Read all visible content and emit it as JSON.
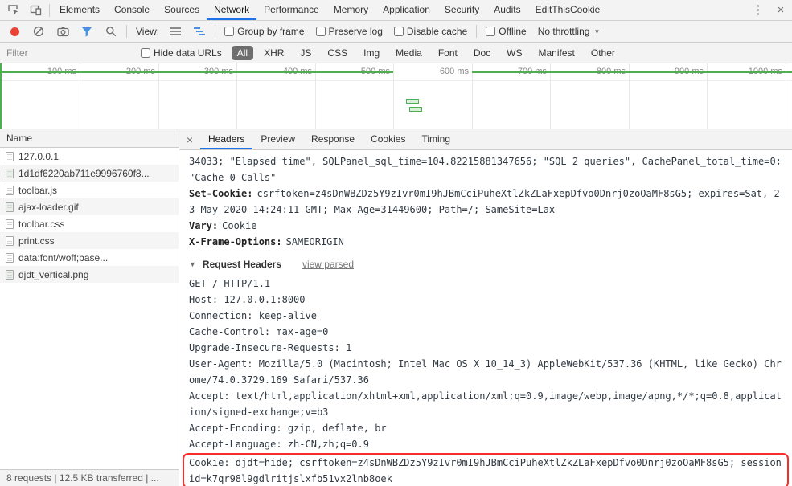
{
  "icons": {
    "kebab_menu": "⋮",
    "close": "×",
    "dropdown_arrow": "▼",
    "disclosure_triangle": "▼"
  },
  "main_tabs": {
    "items": [
      "Elements",
      "Console",
      "Sources",
      "Network",
      "Performance",
      "Memory",
      "Application",
      "Security",
      "Audits",
      "EditThisCookie"
    ],
    "active": "Network"
  },
  "toolbar": {
    "view_label": "View:",
    "checkboxes": [
      "Group by frame",
      "Preserve log",
      "Disable cache",
      "Offline"
    ],
    "throttling": "No throttling"
  },
  "filter_bar": {
    "placeholder": "Filter",
    "hide_data_urls": "Hide data URLs",
    "types": [
      "All",
      "XHR",
      "JS",
      "CSS",
      "Img",
      "Media",
      "Font",
      "Doc",
      "WS",
      "Manifest",
      "Other"
    ],
    "active_type": "All"
  },
  "timeline": {
    "labels": [
      "100 ms",
      "200 ms",
      "300 ms",
      "400 ms",
      "500 ms",
      "600 ms",
      "700 ms",
      "800 ms",
      "900 ms",
      "1000 ms"
    ]
  },
  "requests": {
    "header": "Name",
    "rows": [
      {
        "name": "127.0.0.1",
        "icon": "document-icon"
      },
      {
        "name": "1d1df6220ab711e9996760f8...",
        "icon": "image-icon"
      },
      {
        "name": "toolbar.js",
        "icon": "script-icon"
      },
      {
        "name": "ajax-loader.gif",
        "icon": "image-icon"
      },
      {
        "name": "toolbar.css",
        "icon": "stylesheet-icon"
      },
      {
        "name": "print.css",
        "icon": "stylesheet-icon"
      },
      {
        "name": "data:font/woff;base...",
        "icon": "font-icon"
      },
      {
        "name": "djdt_vertical.png",
        "icon": "image-icon"
      }
    ]
  },
  "details": {
    "close": "×",
    "tabs": [
      "Headers",
      "Preview",
      "Response",
      "Cookies",
      "Timing"
    ],
    "active_tab": "Headers",
    "response": {
      "overflow_line": "34033; \"Elapsed time\", SQLPanel_sql_time=104.82215881347656; \"SQL 2 queries\", CachePanel_total_time=0; \"Cache 0 Calls\"",
      "headers": [
        {
          "name": "Set-Cookie:",
          "value": "csrftoken=z4sDnWBZDz5Y9zIvr0mI9hJBmCciPuheXtlZkZLaFxepDfvo0Dnrj0zoOaMF8sG5; expires=Sat, 23 May 2020 14:24:11 GMT; Max-Age=31449600; Path=/; SameSite=Lax"
        },
        {
          "name": "Vary:",
          "value": "Cookie"
        },
        {
          "name": "X-Frame-Options:",
          "value": "SAMEORIGIN"
        }
      ]
    },
    "request_headers": {
      "title": "Request Headers",
      "view_parsed": "view parsed",
      "raw": [
        "GET / HTTP/1.1",
        "Host: 127.0.0.1:8000",
        "Connection: keep-alive",
        "Cache-Control: max-age=0",
        "Upgrade-Insecure-Requests: 1",
        "User-Agent: Mozilla/5.0 (Macintosh; Intel Mac OS X 10_14_3) AppleWebKit/537.36 (KHTML, like Gecko) Chrome/74.0.3729.169 Safari/537.36",
        "Accept: text/html,application/xhtml+xml,application/xml;q=0.9,image/webp,image/apng,*/*;q=0.8,application/signed-exchange;v=b3",
        "Accept-Encoding: gzip, deflate, br",
        "Accept-Language: zh-CN,zh;q=0.9"
      ],
      "highlighted": "Cookie: djdt=hide; csrftoken=z4sDnWBZDz5Y9zIvr0mI9hJBmCciPuheXtlZkZLaFxepDfvo0Dnrj0zoOaMF8sG5; sessionid=k7qr98l9gdlritjslxfb51vx2lnb8oek"
    }
  },
  "status_bar": {
    "summary": "8 requests | 12.5 KB transferred | ..."
  },
  "colors": {
    "accent_blue": "#1a73e8",
    "record_red": "#ea4335",
    "timeline_green": "#4caf50",
    "highlight_red": "#fa2b2b",
    "active_pill_bg": "#6e6e6e"
  }
}
